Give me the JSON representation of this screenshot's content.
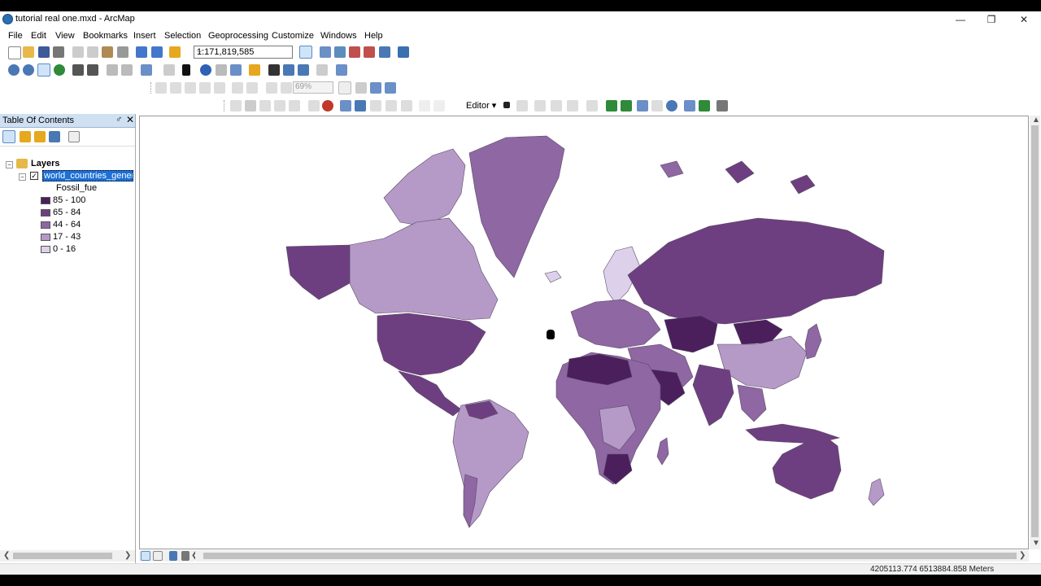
{
  "window": {
    "title": "tutorial real one.mxd - ArcMap",
    "controls": {
      "minimize": "—",
      "restore": "❐",
      "close": "✕"
    }
  },
  "menu": [
    "File",
    "Edit",
    "View",
    "Bookmarks",
    "Insert",
    "Selection",
    "Geoprocessing",
    "Customize",
    "Windows",
    "Help"
  ],
  "toolbar": {
    "scale": "1:171,819,585",
    "zoom_percent": "69%",
    "editor_label": "Editor ▾"
  },
  "toc": {
    "title": "Table Of Contents",
    "pin": "♂",
    "close": "✕",
    "root_label": "Layers",
    "layer_name": "world_countries_generaliz",
    "field_name": "Fossil_fue",
    "legend": [
      {
        "label": "85 - 100",
        "color": "#4b1f5c"
      },
      {
        "label": "65 - 84",
        "color": "#6e3f80"
      },
      {
        "label": "44 - 64",
        "color": "#8e67a3"
      },
      {
        "label": "17 - 43",
        "color": "#b59ac8"
      },
      {
        "label": "0 - 16",
        "color": "#ddd0ea"
      }
    ]
  },
  "status": {
    "coordinates": "4205113.774  6513884.858 Meters"
  }
}
